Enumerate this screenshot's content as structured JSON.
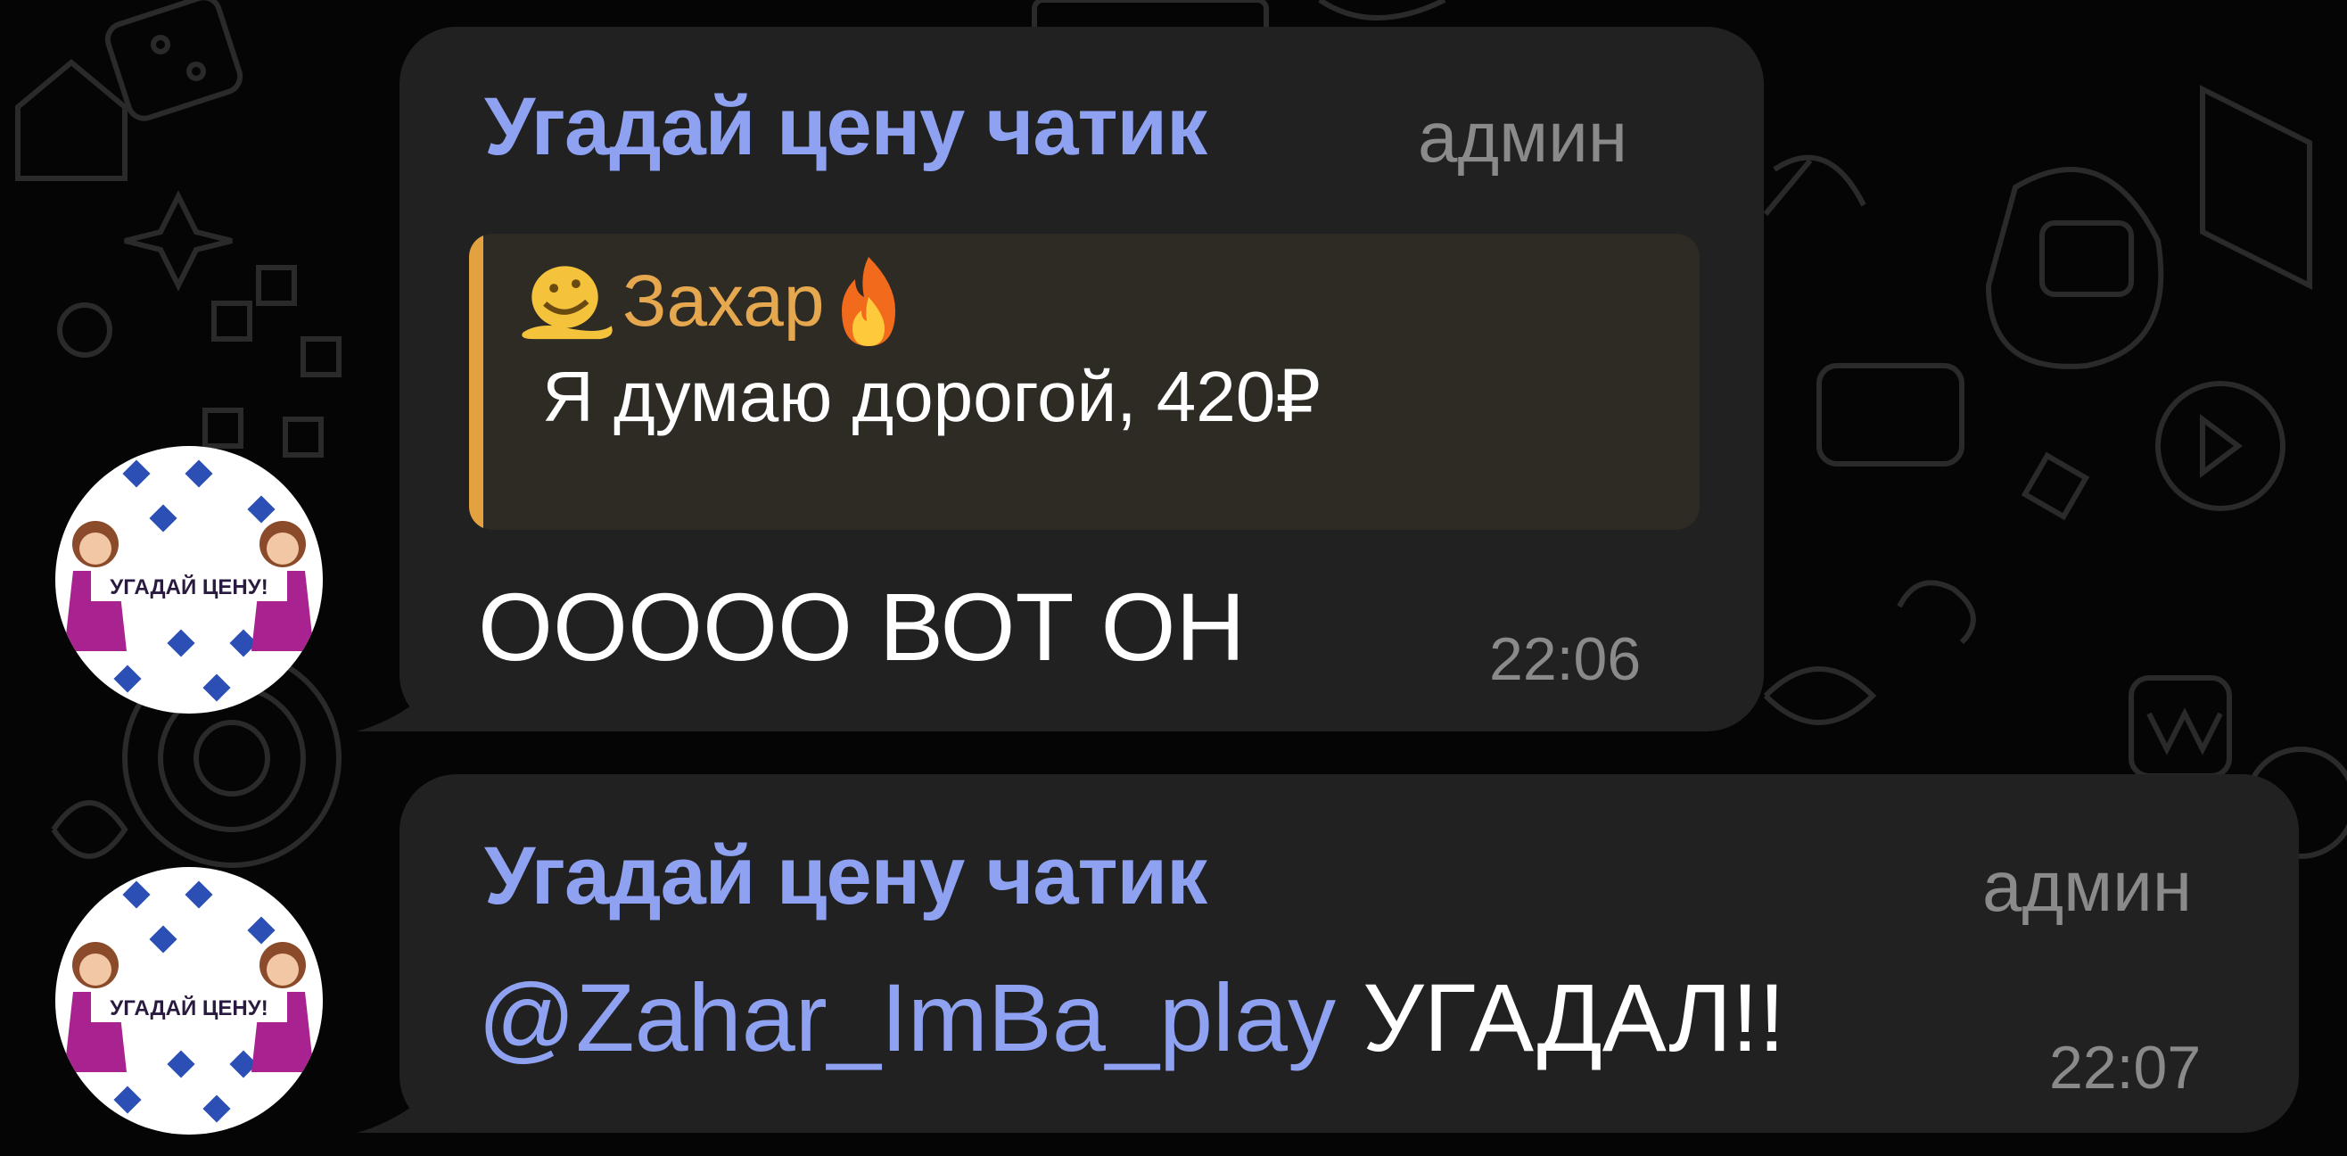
{
  "colors": {
    "background": "#050505",
    "bubble": "#212121",
    "sender_name": "#8fa2f2",
    "role_and_time": "#8a8a8a",
    "reply_accent": "#e3a23f",
    "reply_author": "#e6a84f",
    "mention": "#8fa2f2"
  },
  "messages": [
    {
      "sender": "Угадай цену чатик",
      "role": "админ",
      "reply": {
        "author": "Захар",
        "author_emoji_left": "melting-face-icon",
        "author_emoji_right": "fire-icon",
        "text": "Я думаю дорогой, 420₽"
      },
      "text": "ООООО ВОТ ОН",
      "time": "22:06",
      "avatar_label": "УГАДАЙ ЦЕНУ!"
    },
    {
      "sender": "Угадай цену чатик",
      "role": "админ",
      "mention": "@Zahar_ImBa_play",
      "text": " УГАДАЛ!!",
      "time": "22:07",
      "avatar_label": "УГАДАЙ ЦЕНУ!"
    }
  ]
}
